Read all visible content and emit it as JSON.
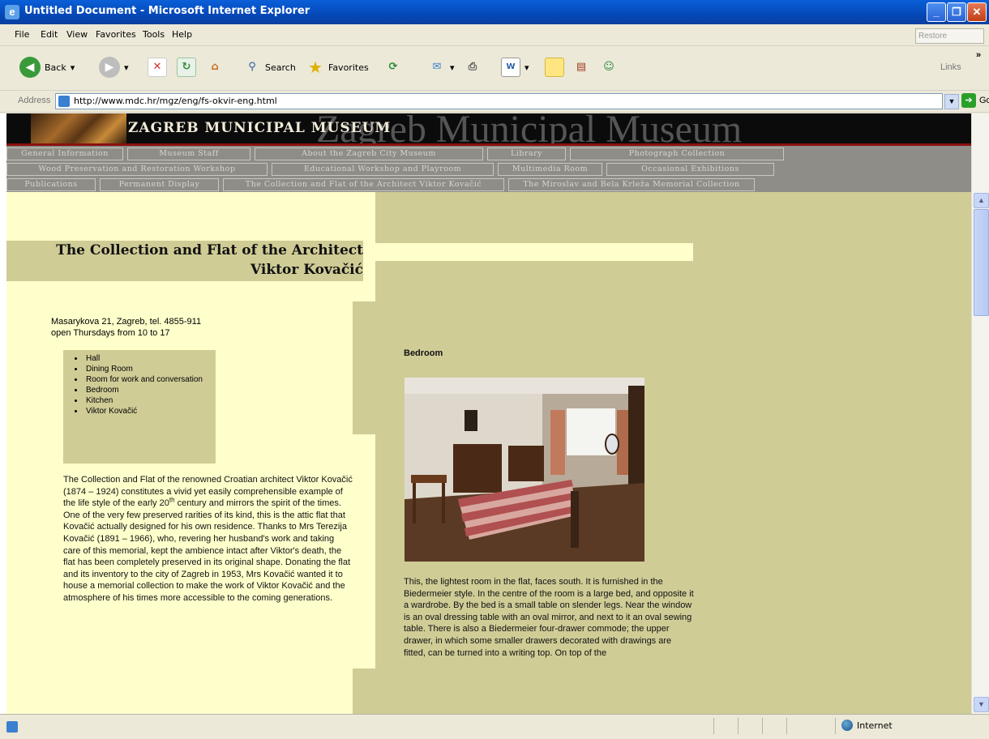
{
  "window": {
    "title": "Untitled Document - Microsoft Internet Explorer",
    "icons": [
      "ie-icon",
      "minimize-icon",
      "maximize-icon",
      "close-icon"
    ]
  },
  "menu": [
    "File",
    "Edit",
    "View",
    "Favorites",
    "Tools",
    "Help"
  ],
  "menu_restore": "Restore",
  "toolbar": {
    "back": "Back",
    "search": "Search",
    "favorites": "Favorites",
    "links": "Links"
  },
  "address": {
    "label": "Address",
    "url": "http://www.mdc.hr/mgz/eng/fs-okvir-eng.html",
    "go": "Go"
  },
  "banner": {
    "small": "ZAGREB MUNICIPAL MUSEUM",
    "big": "Zagreb Municipal Museum"
  },
  "nav": {
    "row1": [
      "General Information",
      "Museum Staff",
      "About the Zagreb City Museum",
      "Library",
      "Photograph Collection"
    ],
    "row2": [
      "Wood Preservation and Restoration Workshop",
      "Educational Workshop and Playroom",
      "Multimedia Room",
      "Occasional Exhibitions"
    ],
    "row3": [
      "Publications",
      "Permanent Display",
      "The Collection and Flat of the Architect Viktor Kovačić",
      "The Miroslav and Bela Krleža Memorial Collection"
    ]
  },
  "page": {
    "title_line1": "The Collection and Flat of the Architect",
    "title_line2": "Viktor Kovačić",
    "address_line1": "Masarykova 21, Zagreb, tel. 4855-911",
    "address_line2": "open Thursdays from 10 to 17",
    "rooms": [
      "Hall",
      "Dining Room",
      "Room for work and conversation",
      "Bedroom",
      "Kitchen",
      "Viktor Kovačić"
    ],
    "body_before_sup": "The Collection and Flat of the renowned Croatian architect Viktor Kovačić (1874 – 1924) constitutes a vivid yet easily comprehensible example of the life style of the early 20",
    "body_sup": "th",
    "body_after_sup": " century and mirrors the spirit of the times. One of the very few preserved rarities of its kind, this is the attic flat that Kovačić actually designed for his own residence. Thanks to Mrs Terezija Kovačić (1891 – 1966), who, revering her husband's work and taking care of this memorial, kept the ambience intact after Viktor's death, the flat has been completely preserved in its original shape. Donating the flat and its inventory to the city of Zagreb in 1953, Mrs Kovačić wanted it to house a memorial collection to make the work of Viktor Kovačić and the atmosphere of his times more accessible to the coming generations.",
    "room_title": "Bedroom",
    "room_text": "This, the lightest room in the flat, faces south. It is furnished in the Biedermeier style. In the centre of the room is a large bed, and opposite it a wardrobe. By the bed is a small table on slender legs. Near the window is an oval dressing table with an oval mirror, and next to it an oval sewing table. There is also a Biedermeier four-drawer commode; the upper drawer, in which some smaller drawers decorated with drawings are fitted, can be turned into a writing top. On top of the"
  },
  "status": {
    "zone": "Internet"
  },
  "colors": {
    "olive": "#cfcc96",
    "cream": "#ffffcc",
    "nav": "#8e8d87",
    "banner": "#0b0b0b"
  }
}
